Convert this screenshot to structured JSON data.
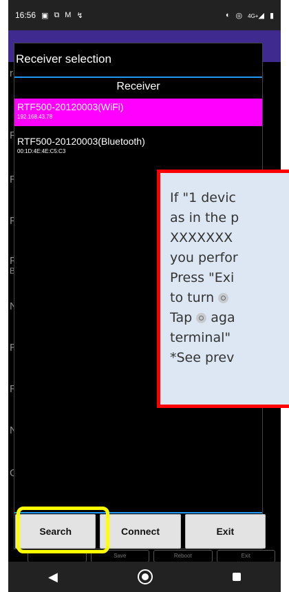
{
  "status_bar": {
    "time": "16:56",
    "left_icons": [
      "image-icon",
      "cast-icon",
      "gmail-icon",
      "missed-call-icon"
    ],
    "right_icons": [
      "vibrate-icon",
      "nfc-icon",
      "4g-signal-icon",
      "battery-icon"
    ],
    "network": "4G+"
  },
  "background_app": {
    "labels": [
      "re",
      "FV",
      "Re",
      "PC",
      "PC",
      "Ba",
      "NI",
      "RT",
      "RT",
      "NI",
      "GI"
    ],
    "bottom_buttons": [
      "",
      "Save",
      "Reboot",
      "Exit"
    ]
  },
  "dialog": {
    "title": "Receiver selection",
    "list_header": "Receiver",
    "items": [
      {
        "name": "RTF500-20120003(WiFi)",
        "address": "192.168.43.78",
        "selected": true
      },
      {
        "name": "RTF500-20120003(Bluetooth)",
        "address": "00:1D:4E:4E:C5:C3",
        "selected": false
      }
    ],
    "buttons": {
      "search": "Search",
      "connect": "Connect",
      "exit": "Exit"
    }
  },
  "callout": {
    "lines": [
      "If \"1 devic",
      "as in the p",
      "XXXXXXX",
      "you perfor",
      "Press \"Exi",
      "to turn",
      "Tap",
      "terminal\"",
      "*See prev"
    ],
    "line6_tail": "",
    "line7_tail": "aga"
  },
  "colors": {
    "selected_item": "#ff00ff",
    "divider": "#2196f3",
    "highlight": "#ffff00",
    "callout_border": "#ff0000",
    "callout_bg": "#dce7f3",
    "app_bar": "#3f2a8f"
  }
}
